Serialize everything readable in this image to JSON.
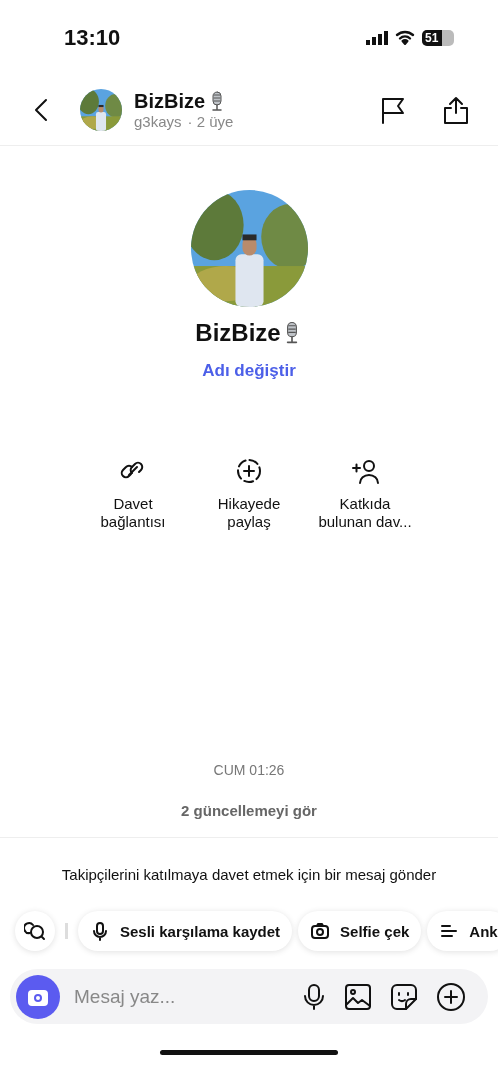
{
  "status_bar": {
    "time": "13:10",
    "battery": "51"
  },
  "header": {
    "title": "BizBize",
    "subtitle": "g3kays",
    "members": "· 2 üye"
  },
  "profile": {
    "name": "BizBize",
    "rename_link": "Adı değiştir"
  },
  "actions": [
    {
      "kind": "link",
      "label": "Davet bağlantısı"
    },
    {
      "kind": "story",
      "label": "Hikayede paylaş"
    },
    {
      "kind": "contributor",
      "label": "Katkıda bulunan dav..."
    }
  ],
  "timestamp": "CUM 01:26",
  "updates_link": "2 güncellemeyi gör",
  "prompt": "Takipçilerini katılmaya davet etmek için bir mesaj gönder",
  "chips": [
    {
      "kind": "mic",
      "label": "Sesli karşılama kaydet"
    },
    {
      "kind": "camera",
      "label": "Selfie çek"
    },
    {
      "kind": "poll",
      "label": "Ank"
    }
  ],
  "composer": {
    "placeholder": "Mesaj yaz..."
  }
}
